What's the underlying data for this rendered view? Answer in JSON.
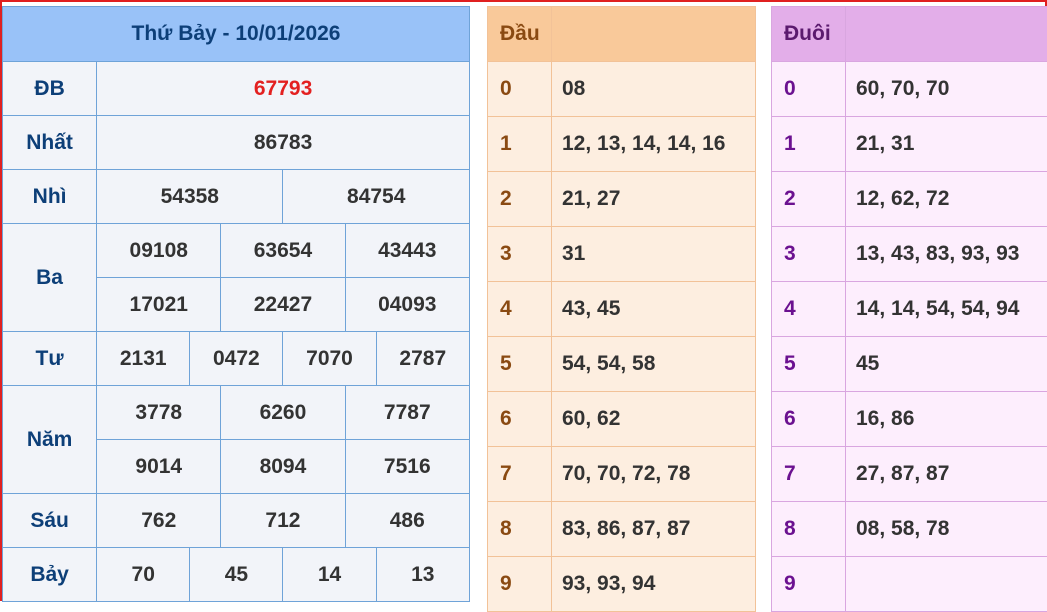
{
  "results": {
    "title": "Thứ Bảy - 10/01/2026",
    "rows": [
      {
        "label": "ĐB",
        "values": [
          "67793"
        ]
      },
      {
        "label": "Nhất",
        "values": [
          "86783"
        ]
      },
      {
        "label": "Nhì",
        "values": [
          "54358",
          "84754"
        ]
      },
      {
        "label": "Ba",
        "values": [
          "09108",
          "63654",
          "43443",
          "17021",
          "22427",
          "04093"
        ]
      },
      {
        "label": "Tư",
        "values": [
          "2131",
          "0472",
          "7070",
          "2787"
        ]
      },
      {
        "label": "Năm",
        "values": [
          "3778",
          "6260",
          "7787",
          "9014",
          "8094",
          "7516"
        ]
      },
      {
        "label": "Sáu",
        "values": [
          "762",
          "712",
          "486"
        ]
      },
      {
        "label": "Bảy",
        "values": [
          "70",
          "45",
          "14",
          "13"
        ]
      }
    ]
  },
  "dau": {
    "title": "Đầu",
    "rows": [
      {
        "k": "0",
        "v": "08"
      },
      {
        "k": "1",
        "v": "12, 13, 14, 14, 16"
      },
      {
        "k": "2",
        "v": "21, 27"
      },
      {
        "k": "3",
        "v": "31"
      },
      {
        "k": "4",
        "v": "43, 45"
      },
      {
        "k": "5",
        "v": "54, 54, 58"
      },
      {
        "k": "6",
        "v": "60, 62"
      },
      {
        "k": "7",
        "v": "70, 70, 72, 78"
      },
      {
        "k": "8",
        "v": "83, 86, 87, 87"
      },
      {
        "k": "9",
        "v": "93, 93, 94"
      }
    ]
  },
  "duoi": {
    "title": "Đuôi",
    "rows": [
      {
        "k": "0",
        "v": "60, 70, 70"
      },
      {
        "k": "1",
        "v": "21, 31"
      },
      {
        "k": "2",
        "v": "12, 62, 72"
      },
      {
        "k": "3",
        "v": "13, 43, 83, 93, 93"
      },
      {
        "k": "4",
        "v": "14, 14, 54, 54, 94"
      },
      {
        "k": "5",
        "v": "45"
      },
      {
        "k": "6",
        "v": "16, 86"
      },
      {
        "k": "7",
        "v": "27, 87, 87"
      },
      {
        "k": "8",
        "v": "08, 58, 78"
      },
      {
        "k": "9",
        "v": ""
      }
    ]
  },
  "colors": {
    "db_value": "#e32020",
    "results_header": "#99c2f8",
    "dau_header": "#f9c99a",
    "duoi_header": "#e3aee9",
    "frame": "#e02020"
  }
}
